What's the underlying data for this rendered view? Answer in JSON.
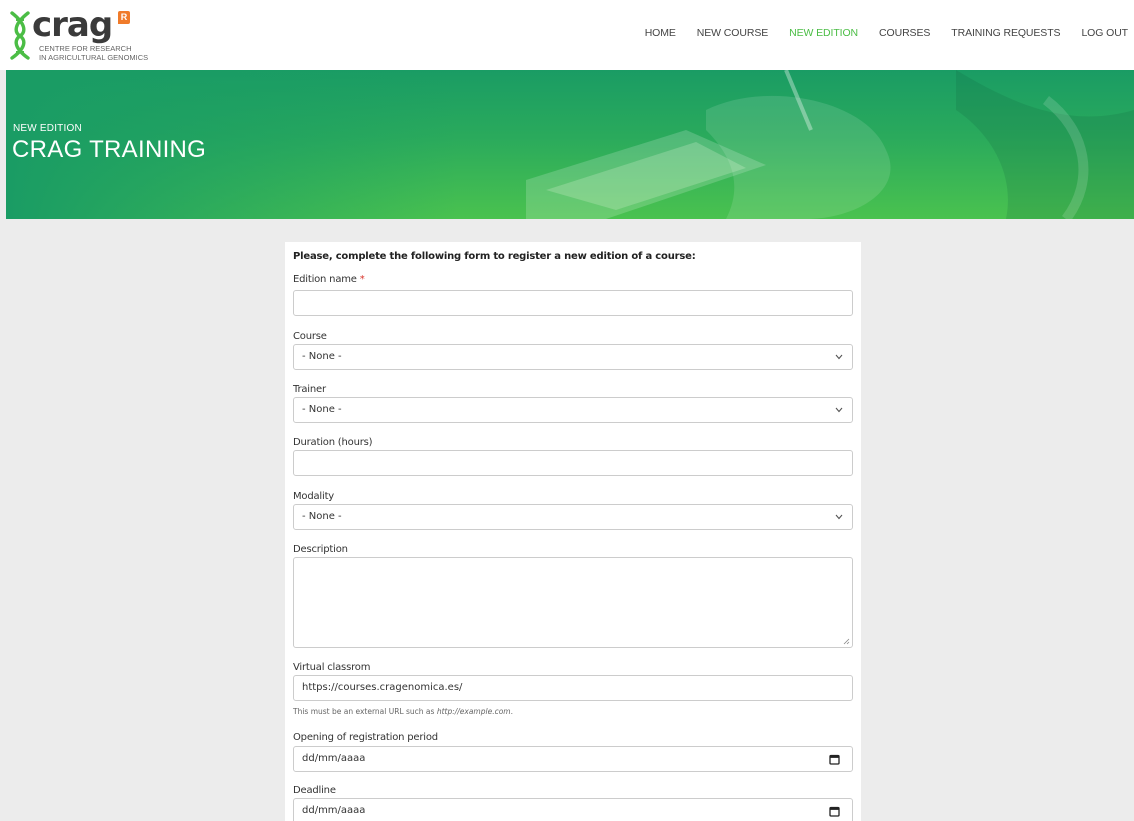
{
  "brand": {
    "name": "crag",
    "subtitle_line1": "CENTRE FOR RESEARCH",
    "subtitle_line2": "IN AGRICULTURAL GENOMICS",
    "badge": "R",
    "accent": "#4bbd45"
  },
  "nav": {
    "items": [
      {
        "label": "HOME",
        "active": false
      },
      {
        "label": "NEW COURSE",
        "active": false
      },
      {
        "label": "NEW EDITION",
        "active": true
      },
      {
        "label": "COURSES",
        "active": false
      },
      {
        "label": "TRAINING REQUESTS",
        "active": false
      },
      {
        "label": "LOG OUT",
        "active": false
      }
    ]
  },
  "banner": {
    "kicker": "NEW EDITION",
    "title": "CRAG TRAINING"
  },
  "form": {
    "intro": "Please, complete the following form to register a new edition of a course:",
    "edition_name": {
      "label": "Edition name",
      "required_mark": "*",
      "value": ""
    },
    "course": {
      "label": "Course",
      "value": "- None -"
    },
    "trainer": {
      "label": "Trainer",
      "value": "- None -"
    },
    "duration": {
      "label": "Duration (hours)",
      "value": ""
    },
    "modality": {
      "label": "Modality",
      "value": "- None -"
    },
    "description": {
      "label": "Description",
      "value": ""
    },
    "virtual_classroom": {
      "label": "Virtual classrom",
      "value": "https://courses.cragenomica.es/",
      "help_prefix": "This must be an external URL such as ",
      "help_example": "http://example.com",
      "help_suffix": "."
    },
    "registration_opening": {
      "label": "Opening of registration period",
      "value": "dd/mm/aaaa"
    },
    "deadline": {
      "label": "Deadline",
      "value": "dd/mm/aaaa"
    }
  }
}
